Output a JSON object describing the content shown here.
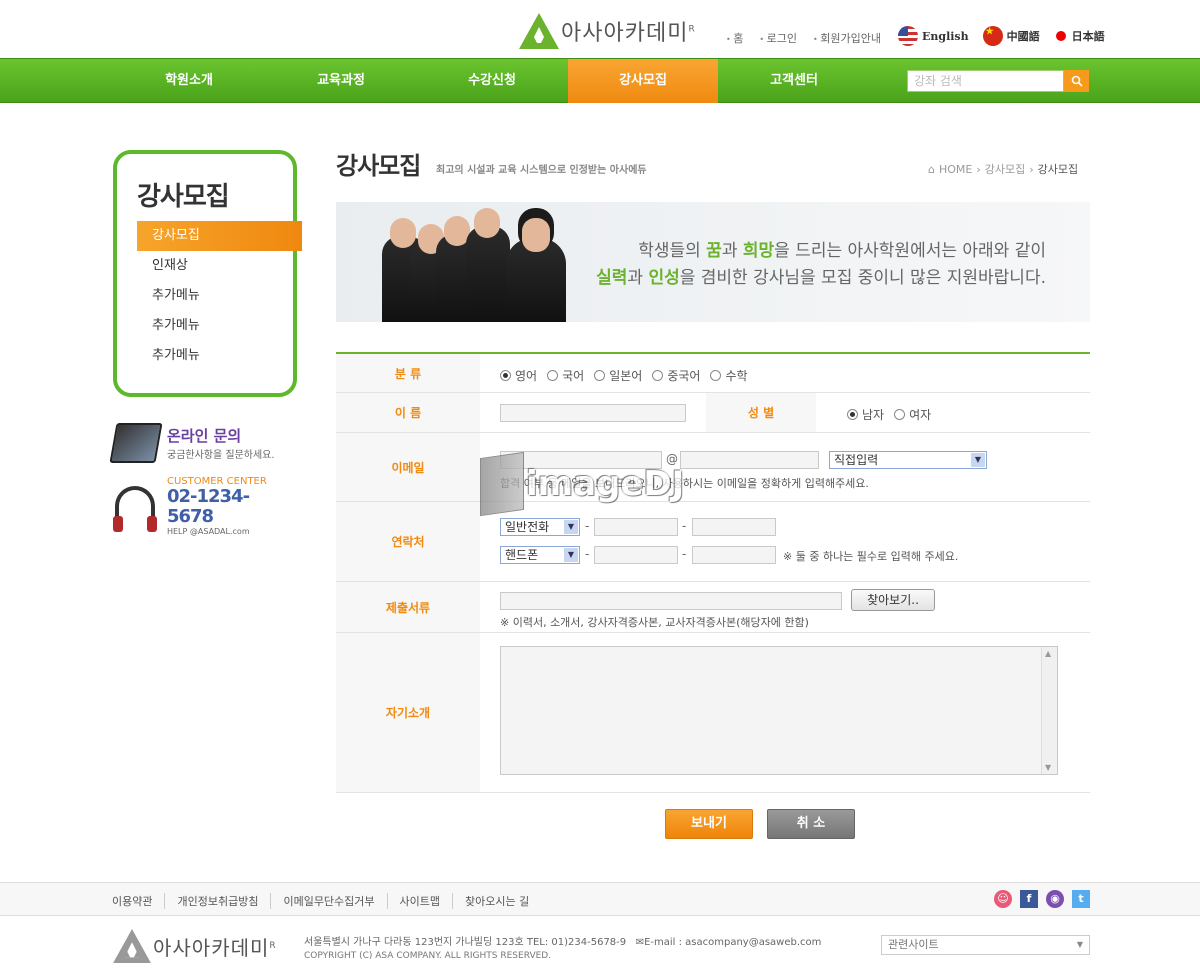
{
  "header": {
    "brand": "아사아카데미",
    "brand_mark": "R",
    "top_links": [
      "홈",
      "로그인",
      "회원가입안내"
    ],
    "languages": [
      {
        "label": "English",
        "flag": "us-flag-icon"
      },
      {
        "label": "中國語",
        "flag": "china-flag-icon"
      },
      {
        "label": "日本語",
        "flag": "japan-flag-icon"
      }
    ]
  },
  "nav": {
    "items": [
      "학원소개",
      "교육과정",
      "수강신청",
      "강사모집",
      "고객센터"
    ],
    "active_index": 3,
    "search_placeholder": "강좌 검색"
  },
  "sidebar": {
    "title": "강사모집",
    "items": [
      "강사모집",
      "인재상",
      "추가메뉴",
      "추가메뉴",
      "추가메뉴"
    ],
    "active_index": 0,
    "inquiry_title": "온라인 문의",
    "inquiry_sub": "궁금한사항을 질문하세요.",
    "cc_label": "CUSTOMER CENTER",
    "cc_phone": "02-1234-5678",
    "cc_help": "HELP @ASADAL.com"
  },
  "page": {
    "title": "강사모집",
    "subtitle": "최고의 시설과 교육 시스템으로 인정받는 아사에듀",
    "breadcrumb": [
      "HOME",
      "강사모집",
      "강사모집"
    ],
    "hero_line1_a": "학생들의 ",
    "hero_line1_b": "꿈",
    "hero_line1_c": "과 ",
    "hero_line1_d": "희망",
    "hero_line1_e": "을 드리는 아사학원에서는 아래와 같이",
    "hero_line2_a": "실력",
    "hero_line2_b": "과 ",
    "hero_line2_c": "인성",
    "hero_line2_d": "을 겸비한 강사님을 모집 중이니 많은 지원바랍니다."
  },
  "form": {
    "category_label": "분 류",
    "categories": [
      "영어",
      "국어",
      "일본어",
      "중국어",
      "수학"
    ],
    "category_selected": 0,
    "name_label": "이 름",
    "name_value": "",
    "gender_label": "성 별",
    "genders": [
      "남자",
      "여자"
    ],
    "gender_selected": 0,
    "email_label": "이메일",
    "email_at": "@",
    "email_domain_select": "직접입력",
    "email_note": "합격 여부 등 메일을 보내드리오니, 사용하시는 이메일을 정확하게 입력해주세요.",
    "contact_label": "연락처",
    "phone_type1": "일반전화",
    "phone_type2": "핸드폰",
    "contact_note": "※ 둘 중 하나는 필수로 입력해 주세요.",
    "docs_label": "제출서류",
    "browse_label": "찾아보기..",
    "docs_note": "※ 이력서, 소개서, 강사자격증사본, 교사자격증사본(해당자에 한함)",
    "intro_label": "자기소개",
    "intro_value": "",
    "submit_label": "보내기",
    "cancel_label": "취 소"
  },
  "watermark": "imageDJ",
  "footer": {
    "links": [
      "이용약관",
      "개인정보취급방침",
      "이메일무단수집거부",
      "사이트맵",
      "찾아오시는 길"
    ],
    "sns": [
      "kakao-icon",
      "facebook-icon",
      "blog-icon",
      "twitter-icon"
    ],
    "brand": "아사아카데미",
    "address": "서울특별시 가나구 다라동  123번지 가나빌딩 123호    TEL: 01)234-5678-9",
    "email": "E-mail : asacompany@asaweb.com",
    "copyright": "COPYRIGHT (C) ASA COMPANY. ALL RIGHTS RESERVED.",
    "related_site": "관련사이트"
  },
  "colors": {
    "green": "#5db92a",
    "orange": "#f08a10",
    "purple": "#6a3fa0",
    "blue": "#3f5fa8"
  }
}
